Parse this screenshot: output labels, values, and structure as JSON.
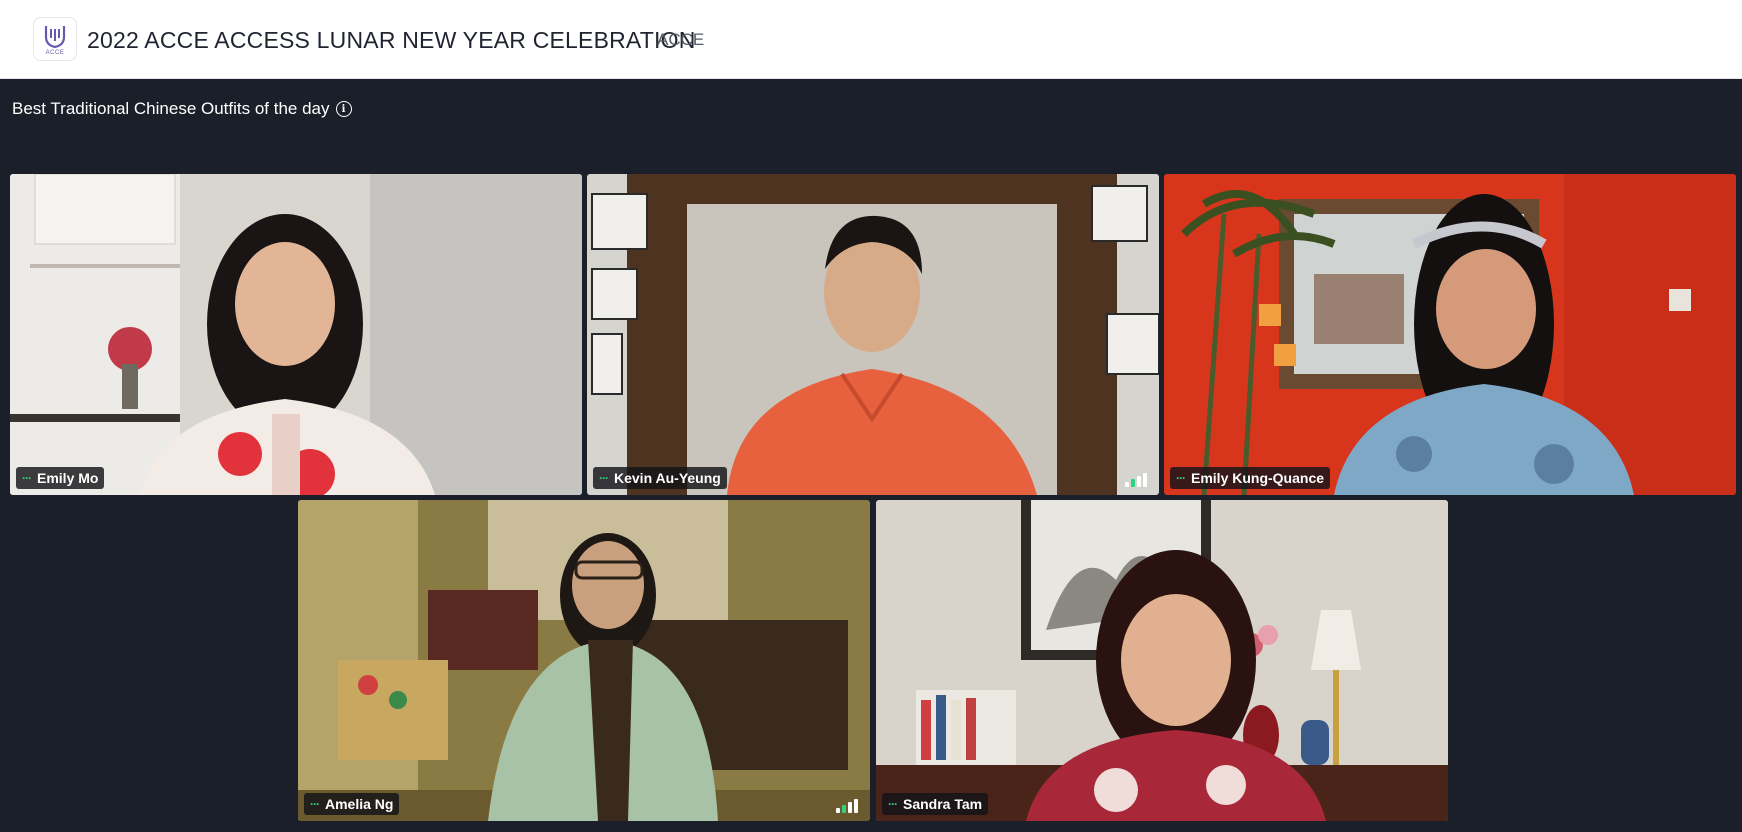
{
  "header": {
    "event_title": "2022 ACCE ACCESS LUNAR NEW YEAR CELEBRATION",
    "org_label": "ACCE",
    "logo_text": "ACCE"
  },
  "session": {
    "title": "Best Traditional Chinese Outfits of the day",
    "info_icon": "info-circle-icon"
  },
  "participants": [
    {
      "name": "Emily Mo",
      "background": "#d9d6d0",
      "outfit": "#f3ece6",
      "accent": "#e2323c"
    },
    {
      "name": "Kevin Au-Yeung",
      "background": "#bdb8b0",
      "outfit": "#e8613e",
      "accent": "#5a3a22"
    },
    {
      "name": "Emily Kung-Quance",
      "background": "#d8361c",
      "outfit": "#7fa8c6",
      "accent": "#7a5a3a"
    },
    {
      "name": "Amelia Ng",
      "background": "#8a7a44",
      "outfit": "#a8c2a8",
      "accent": "#3a2a1e"
    },
    {
      "name": "Sandra Tam",
      "background": "#d8d4cc",
      "outfit": "#a8283a",
      "accent": "#2e2a26"
    }
  ],
  "status_indicators": {
    "speaking_dots": "···",
    "network_icon": "signal-bars-icon",
    "accent_green": "#2fd37a"
  }
}
